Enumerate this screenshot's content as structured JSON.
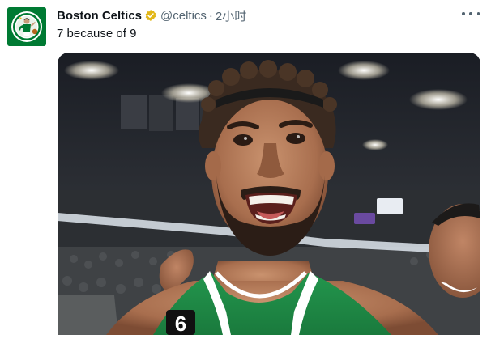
{
  "tweet": {
    "display_name": "Boston Celtics",
    "handle": "@celtics",
    "separator": "·",
    "time": "2小时",
    "text": "7 because of 9",
    "verified_icon": "verified-gold-badge-icon",
    "more_icon": "more-horizontal-icon"
  },
  "media": {
    "jersey_number": "6",
    "jersey_color": "#1f8a46"
  },
  "colors": {
    "brand_green": "#007a33",
    "verified_gold": "#e2b719",
    "secondary_text": "#536471",
    "primary_text": "#0f1419"
  }
}
